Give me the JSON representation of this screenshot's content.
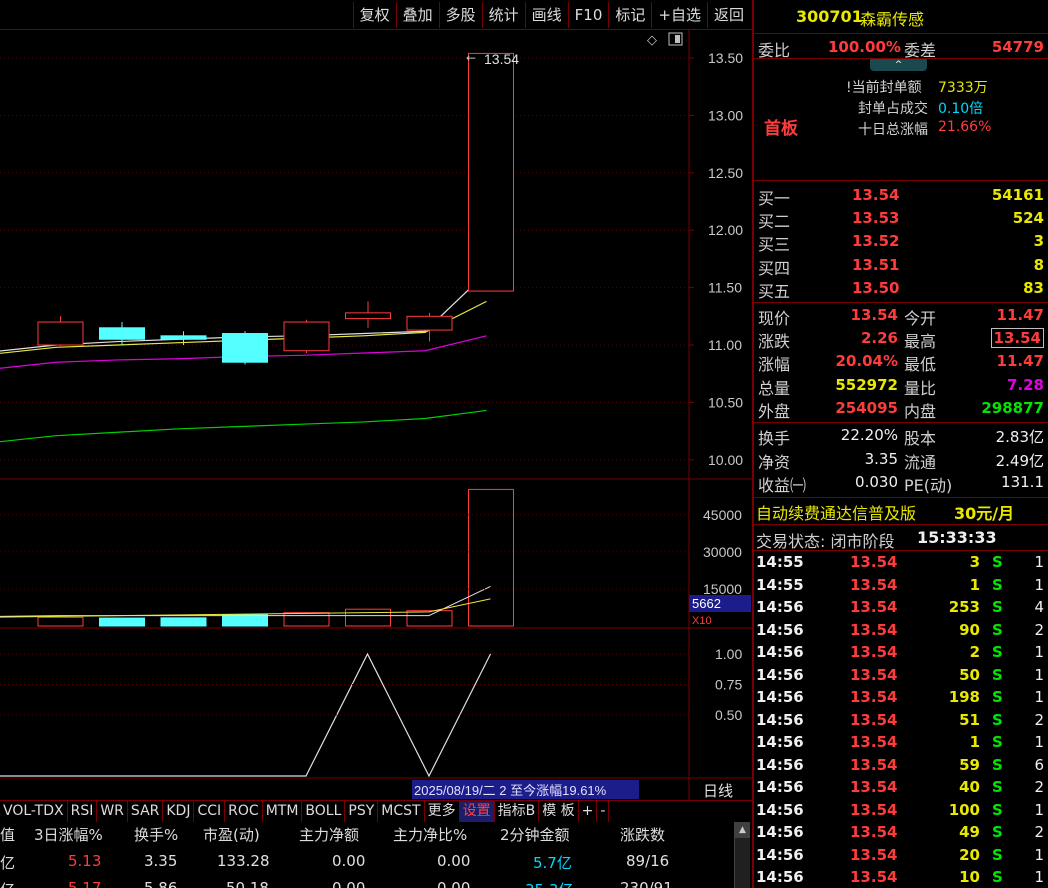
{
  "toolbar": {
    "buttons": [
      "复权",
      "叠加",
      "多股",
      "统计",
      "画线",
      "F10",
      "标记",
      "+自选",
      "返回"
    ]
  },
  "chart": {
    "price_axis": [
      "13.50",
      "13.00",
      "12.50",
      "12.00",
      "11.50",
      "11.00",
      "10.50",
      "10.00"
    ],
    "high_annotation": "13.54",
    "volume_axis": [
      "45000",
      "30000",
      "15000"
    ],
    "volume_current": "5662",
    "volume_unit": "X10",
    "indicator_axis": [
      "1.00",
      "0.75",
      "0.50"
    ],
    "status_bar": "2025/08/19/二 2 至今涨幅19.61%",
    "period": "日线"
  },
  "chart_data": {
    "type": "candlestick",
    "candles": [
      {
        "open": 11.0,
        "close": 11.2,
        "high": 11.25,
        "low": 10.98,
        "volume": 3500
      },
      {
        "open": 11.15,
        "close": 11.05,
        "high": 11.2,
        "low": 11.0,
        "volume": 3200
      },
      {
        "open": 11.08,
        "close": 11.05,
        "high": 11.12,
        "low": 11.0,
        "volume": 3300
      },
      {
        "open": 11.1,
        "close": 10.85,
        "high": 11.12,
        "low": 10.83,
        "volume": 4600
      },
      {
        "open": 10.95,
        "close": 11.2,
        "high": 11.22,
        "low": 10.93,
        "volume": 5400
      },
      {
        "open": 11.23,
        "close": 11.28,
        "high": 11.38,
        "low": 11.15,
        "volume": 6800
      },
      {
        "open": 11.13,
        "close": 11.25,
        "high": 11.28,
        "low": 11.03,
        "volume": 6200
      },
      {
        "open": 11.47,
        "close": 13.54,
        "high": 13.54,
        "low": 11.47,
        "volume": 55297
      }
    ],
    "ma_white": [
      11.0,
      11.03,
      11.05,
      11.07,
      11.08,
      11.1,
      11.12,
      11.63
    ],
    "ma_yellow": [
      10.98,
      11.0,
      11.02,
      11.04,
      11.06,
      11.08,
      11.11,
      11.38
    ],
    "ma_magenta": [
      10.85,
      10.87,
      10.88,
      10.9,
      10.91,
      10.93,
      10.95,
      11.08
    ],
    "ma_green": [
      10.21,
      10.24,
      10.27,
      10.29,
      10.31,
      10.33,
      10.36,
      10.43
    ],
    "indicator": [
      0,
      0,
      0,
      0,
      0,
      1,
      0,
      1
    ]
  },
  "indicator_tabs": [
    "VOL-TDX",
    "RSI",
    "WR",
    "SAR",
    "KDJ",
    "CCI",
    "ROC",
    "MTM",
    "BOLL",
    "PSY",
    "MCST",
    "更多",
    "设置",
    "指标B",
    "模 板",
    "+",
    "-"
  ],
  "bottom_table": {
    "headers": [
      "值",
      "3日涨幅%",
      "换手%",
      "市盈(动)",
      "主力净额",
      "主力净比%",
      "2分钟金额",
      "涨跌数"
    ],
    "rows": [
      [
        "亿",
        "5.13",
        "3.35",
        "133.28",
        "0.00",
        "0.00",
        "5.7亿",
        "89/16"
      ],
      [
        "亿",
        "5.17",
        "5.86",
        "50.18",
        "0.00",
        "0.00",
        "35.3亿",
        "230/91"
      ]
    ]
  },
  "stock": {
    "code": "300701",
    "name": "森霸传感"
  },
  "order_ratio": {
    "label1": "委比",
    "value1": "100.00%",
    "label2": "委差",
    "value2": "54779"
  },
  "limit_info": {
    "badge": "首板",
    "rows": [
      {
        "label": "!当前封单额",
        "value": "7333万"
      },
      {
        "label": "封单占成交",
        "value": "0.10倍"
      },
      {
        "label": "十日总涨幅",
        "value": "21.66%"
      }
    ]
  },
  "bids": [
    {
      "label": "买一",
      "price": "13.54",
      "vol": "54161"
    },
    {
      "label": "买二",
      "price": "13.53",
      "vol": "524"
    },
    {
      "label": "买三",
      "price": "13.52",
      "vol": "3"
    },
    {
      "label": "买四",
      "price": "13.51",
      "vol": "8"
    },
    {
      "label": "买五",
      "price": "13.50",
      "vol": "83"
    }
  ],
  "quote": [
    {
      "l1": "现价",
      "v1": "13.54",
      "l2": "今开",
      "v2": "11.47"
    },
    {
      "l1": "涨跌",
      "v1": "2.26",
      "l2": "最高",
      "v2": "13.54"
    },
    {
      "l1": "涨幅",
      "v1": "20.04%",
      "l2": "最低",
      "v2": "11.47"
    },
    {
      "l1": "总量",
      "v1": "552972",
      "l2": "量比",
      "v2": "7.28"
    },
    {
      "l1": "外盘",
      "v1": "254095",
      "l2": "内盘",
      "v2": "298877"
    }
  ],
  "fundamentals": [
    {
      "l1": "换手",
      "v1": "22.20%",
      "l2": "股本",
      "v2": "2.83亿"
    },
    {
      "l1": "净资",
      "v1": "3.35",
      "l2": "流通",
      "v2": "2.49亿"
    },
    {
      "l1": "收益㈠",
      "v1": "0.030",
      "l2": "PE(动)",
      "v2": "131.1"
    }
  ],
  "promo": {
    "text": "自动续费通达信普及版",
    "price": "30元/月"
  },
  "trade_status": {
    "label": "交易状态: 闭市阶段",
    "time": "15:33:33"
  },
  "ticks": [
    {
      "time": "14:55",
      "price": "13.54",
      "vol": "3",
      "side": "S",
      "n": "1"
    },
    {
      "time": "14:55",
      "price": "13.54",
      "vol": "1",
      "side": "S",
      "n": "1"
    },
    {
      "time": "14:56",
      "price": "13.54",
      "vol": "253",
      "side": "S",
      "n": "4"
    },
    {
      "time": "14:56",
      "price": "13.54",
      "vol": "90",
      "side": "S",
      "n": "2"
    },
    {
      "time": "14:56",
      "price": "13.54",
      "vol": "2",
      "side": "S",
      "n": "1"
    },
    {
      "time": "14:56",
      "price": "13.54",
      "vol": "50",
      "side": "S",
      "n": "1"
    },
    {
      "time": "14:56",
      "price": "13.54",
      "vol": "198",
      "side": "S",
      "n": "1"
    },
    {
      "time": "14:56",
      "price": "13.54",
      "vol": "51",
      "side": "S",
      "n": "2"
    },
    {
      "time": "14:56",
      "price": "13.54",
      "vol": "1",
      "side": "S",
      "n": "1"
    },
    {
      "time": "14:56",
      "price": "13.54",
      "vol": "59",
      "side": "S",
      "n": "6"
    },
    {
      "time": "14:56",
      "price": "13.54",
      "vol": "40",
      "side": "S",
      "n": "2"
    },
    {
      "time": "14:56",
      "price": "13.54",
      "vol": "100",
      "side": "S",
      "n": "1"
    },
    {
      "time": "14:56",
      "price": "13.54",
      "vol": "49",
      "side": "S",
      "n": "2"
    },
    {
      "time": "14:56",
      "price": "13.54",
      "vol": "20",
      "side": "S",
      "n": "1"
    },
    {
      "time": "14:56",
      "price": "13.54",
      "vol": "10",
      "side": "S",
      "n": "1"
    }
  ],
  "colors": {
    "up": "#ff3c3c",
    "down": "#54ffff",
    "frame": "#7a0000"
  }
}
